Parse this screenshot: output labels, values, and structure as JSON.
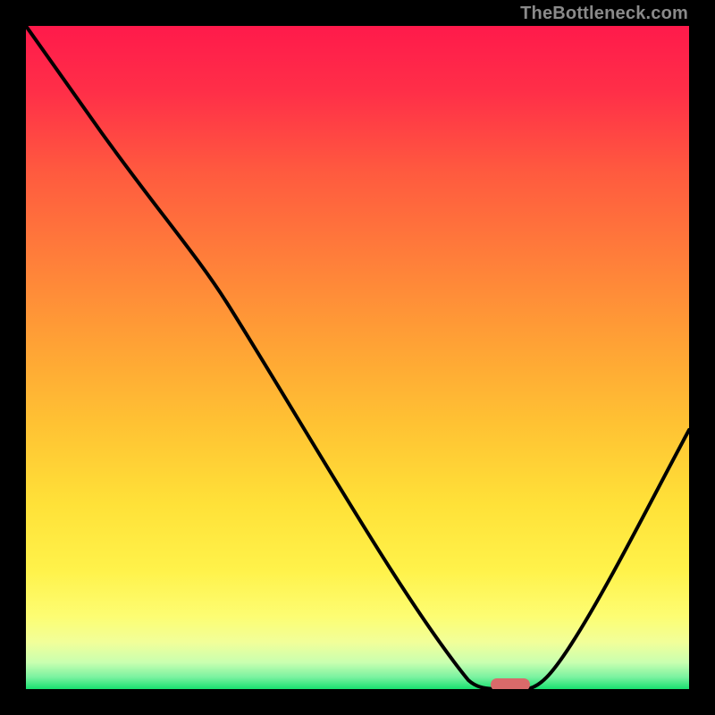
{
  "watermark": "TheBottleneck.com",
  "chart_data": {
    "type": "line",
    "title": "",
    "xlabel": "",
    "ylabel": "",
    "xlim": [
      0,
      100
    ],
    "ylim": [
      0,
      100
    ],
    "grid": false,
    "background": "heat-gradient red→orange→yellow→green (top→bottom)",
    "series": [
      {
        "name": "bottleneck-curve",
        "x": [
          0,
          12,
          20,
          30,
          40,
          50,
          60,
          67,
          72,
          76,
          80,
          85,
          90,
          95,
          100
        ],
        "y": [
          100,
          84,
          72,
          58,
          42,
          28,
          14,
          2,
          0,
          0,
          2,
          9,
          20,
          30,
          40
        ]
      }
    ],
    "annotations": [
      {
        "name": "optimal-marker",
        "shape": "rounded-rect",
        "x": 73,
        "y": 0,
        "color": "#d96a6a"
      }
    ],
    "gradient_stops": [
      {
        "pos": 0.0,
        "color": "#ff1a4b"
      },
      {
        "pos": 0.35,
        "color": "#ff7e3a"
      },
      {
        "pos": 0.72,
        "color": "#ffe138"
      },
      {
        "pos": 0.93,
        "color": "#f1ff9a"
      },
      {
        "pos": 1.0,
        "color": "#18e06f"
      }
    ]
  }
}
